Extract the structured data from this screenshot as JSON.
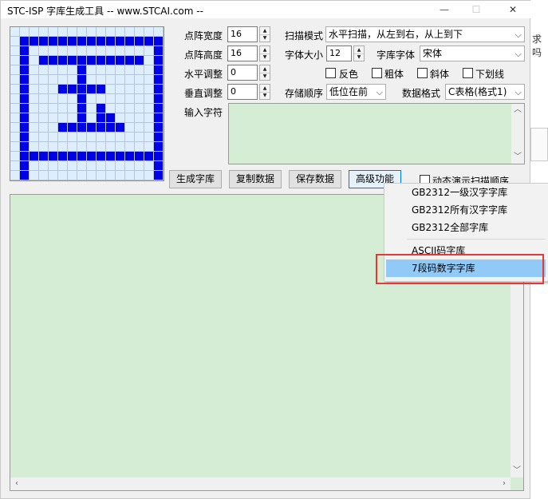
{
  "window": {
    "title": "STC-ISP 字库生成工具 -- www.STCAI.com --"
  },
  "title_buttons": {
    "minimize": "—",
    "maximize": "☐",
    "close": "✕"
  },
  "background_window": {
    "partial_text": "求吗"
  },
  "preview": {
    "rows": [
      "................",
      ".###############",
      ".#.............#",
      ".#.###########.#",
      ".#.....#.......#",
      ".#.....#.......#",
      ".#...#####.....#",
      ".#.....#.......#",
      ".#.....#.#.....#",
      ".#.....#.##....#",
      ".#...#######...#",
      ".#.............#",
      ".#.............#",
      ".###############",
      ".#.............#",
      ".#.............#"
    ],
    "colors": {
      "on": "#0000e6",
      "off": "#ddeeff"
    }
  },
  "settings": {
    "dot_width_label": "点阵宽度",
    "dot_width_value": "16",
    "dot_height_label": "点阵高度",
    "dot_height_value": "16",
    "h_adjust_label": "水平调整",
    "h_adjust_value": "0",
    "v_adjust_label": "垂直调整",
    "v_adjust_value": "0",
    "scan_mode_label": "扫描模式",
    "scan_mode_value": "水平扫描，从左到右，从上到下",
    "font_size_label": "字体大小",
    "font_size_value": "12",
    "font_face_label": "字库字体",
    "font_face_value": "宋体",
    "checkbox_invert": "反色",
    "checkbox_bold": "粗体",
    "checkbox_italic": "斜体",
    "checkbox_underline": "下划线",
    "storage_order_label": "存储顺序",
    "storage_order_value": "低位在前",
    "data_format_label": "数据格式",
    "data_format_value": "C表格(格式1)",
    "input_chars_label": "输入字符"
  },
  "buttons": {
    "generate": "生成字库",
    "copy": "复制数据",
    "save": "保存数据",
    "advanced": "高级功能",
    "dynamic_demo": "动态演示扫描顺序"
  },
  "menu": {
    "items": [
      {
        "label": "GB2312一级汉字字库"
      },
      {
        "label": "GB2312所有汉字字库"
      },
      {
        "label": "GB2312全部字库"
      },
      {
        "label": "ASCII码字库"
      },
      {
        "label": "7段码数字字库"
      }
    ]
  },
  "scroll_glyphs": {
    "up": "︿",
    "down": "﹀",
    "left": "‹",
    "right": "›"
  },
  "colors": {
    "output_bg": "#d5ecd5",
    "menu_highlight": "#91c9f7",
    "annotation_red": "#e53935"
  }
}
